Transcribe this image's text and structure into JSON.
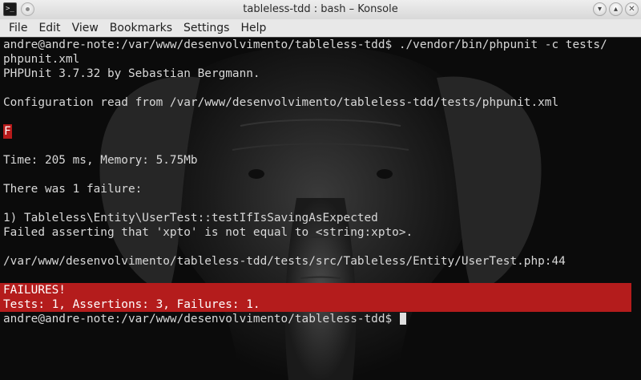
{
  "window": {
    "title": "tableless-tdd : bash – Konsole",
    "buttons": {
      "minimize": "▾",
      "maximize": "▴",
      "close": "✕"
    },
    "app_icon_glyph": ">_"
  },
  "menu": {
    "items": [
      "File",
      "Edit",
      "View",
      "Bookmarks",
      "Settings",
      "Help"
    ]
  },
  "terminal": {
    "lines": [
      "andre@andre-note:/var/www/desenvolvimento/tableless-tdd$ ./vendor/bin/phpunit -c tests/",
      "phpunit.xml",
      "PHPUnit 3.7.32 by Sebastian Bergmann.",
      "",
      "Configuration read from /var/www/desenvolvimento/tableless-tdd/tests/phpunit.xml",
      "",
      "F",
      "",
      "Time: 205 ms, Memory: 5.75Mb",
      "",
      "There was 1 failure:",
      "",
      "1) Tableless\\Entity\\UserTest::testIfIsSavingAsExpected",
      "Failed asserting that 'xpto' is not equal to <string:xpto>.",
      "",
      "/var/www/desenvolvimento/tableless-tdd/tests/src/Tableless/Entity/UserTest.php:44",
      ""
    ],
    "failure_summary": [
      "FAILURES!",
      "Tests: 1, Assertions: 3, Failures: 1."
    ],
    "prompt": "andre@andre-note:/var/www/desenvolvimento/tableless-tdd$ "
  },
  "colors": {
    "terminal_bg": "#0b0b0b",
    "terminal_fg": "#d8d8d8",
    "failure_bg": "#b41c1c"
  }
}
